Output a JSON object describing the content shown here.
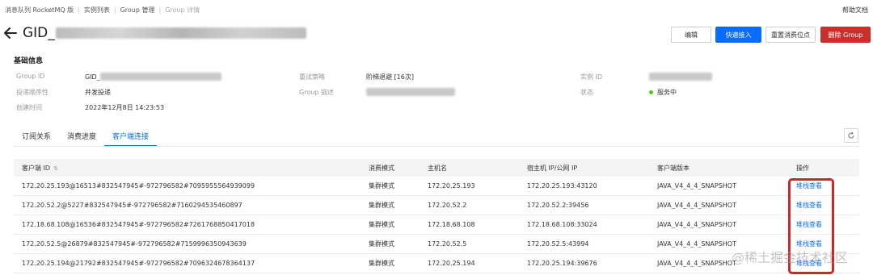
{
  "breadcrumb": {
    "items": [
      "消息队列 RocketMQ 版",
      "实例列表",
      "Group 管理",
      "Group 详情"
    ]
  },
  "help_link": "帮助文档",
  "title": {
    "prefix": "GID_"
  },
  "buttons": {
    "edit": "编辑",
    "quick_access": "快速接入",
    "reset_offset": "重置消费位点",
    "delete_group": "删除 Group"
  },
  "basic_info": {
    "section_title": "基础信息",
    "group_id_label": "Group ID",
    "group_id_value_prefix": "GID_",
    "retry_policy_label": "重试策略",
    "retry_policy_value": "阶梯退避 [16次]",
    "instance_id_label": "实例 ID",
    "delivery_order_label": "投递顺序性",
    "delivery_order_value": "并发投递",
    "group_desc_label": "Group 描述",
    "status_label": "状态",
    "status_value": "服务中",
    "created_label": "创建时间",
    "created_value": "2022年12月8日 14:23:53"
  },
  "tabs": [
    "订阅关系",
    "消费进度",
    "客户端连接"
  ],
  "active_tab": 2,
  "table": {
    "headers": [
      "客户端 ID",
      "消费模式",
      "主机名",
      "宿主机 IP/公网 IP",
      "客户端版本",
      "操作"
    ],
    "rows": [
      {
        "client_id": "172.20.25.193@16513#832547945#-972796582#7095955564939099",
        "mode": "集群模式",
        "host": "172.20.25.193",
        "ip": "172.20.25.193:43120",
        "version": "JAVA_V4_4_4_SNAPSHOT",
        "action": "堆栈查看"
      },
      {
        "client_id": "172.20.52.2@5227#832547945#-972796582#7160294535460897",
        "mode": "集群模式",
        "host": "172.20.52.2",
        "ip": "172.20.52.2:39456",
        "version": "JAVA_V4_4_4_SNAPSHOT",
        "action": "堆栈查看"
      },
      {
        "client_id": "172.18.68.108@16536#832547945#-972796582#7261768850417018",
        "mode": "集群模式",
        "host": "172.18.68.108",
        "ip": "172.18.68.108:33024",
        "version": "JAVA_V4_4_4_SNAPSHOT",
        "action": "堆栈查看"
      },
      {
        "client_id": "172.20.52.5@26879#832547945#-972796582#7159996350943639",
        "mode": "集群模式",
        "host": "172.20.52.5",
        "ip": "172.20.52.5:43994",
        "version": "JAVA_V4_4_4_SNAPSHOT",
        "action": "堆栈查看"
      },
      {
        "client_id": "172.20.25.194@21792#832547945#-972796582#7096324678364137",
        "mode": "集群模式",
        "host": "172.20.25.194",
        "ip": "172.20.25.194:39676",
        "version": "JAVA_V4_4_4_SNAPSHOT",
        "action": "堆栈查看"
      }
    ]
  },
  "watermark": "@稀土掘金技术社区",
  "colors": {
    "primary": "#0a6cff",
    "danger": "#c9302c",
    "status_ok": "#52c41a",
    "highlight": "#e02020"
  }
}
